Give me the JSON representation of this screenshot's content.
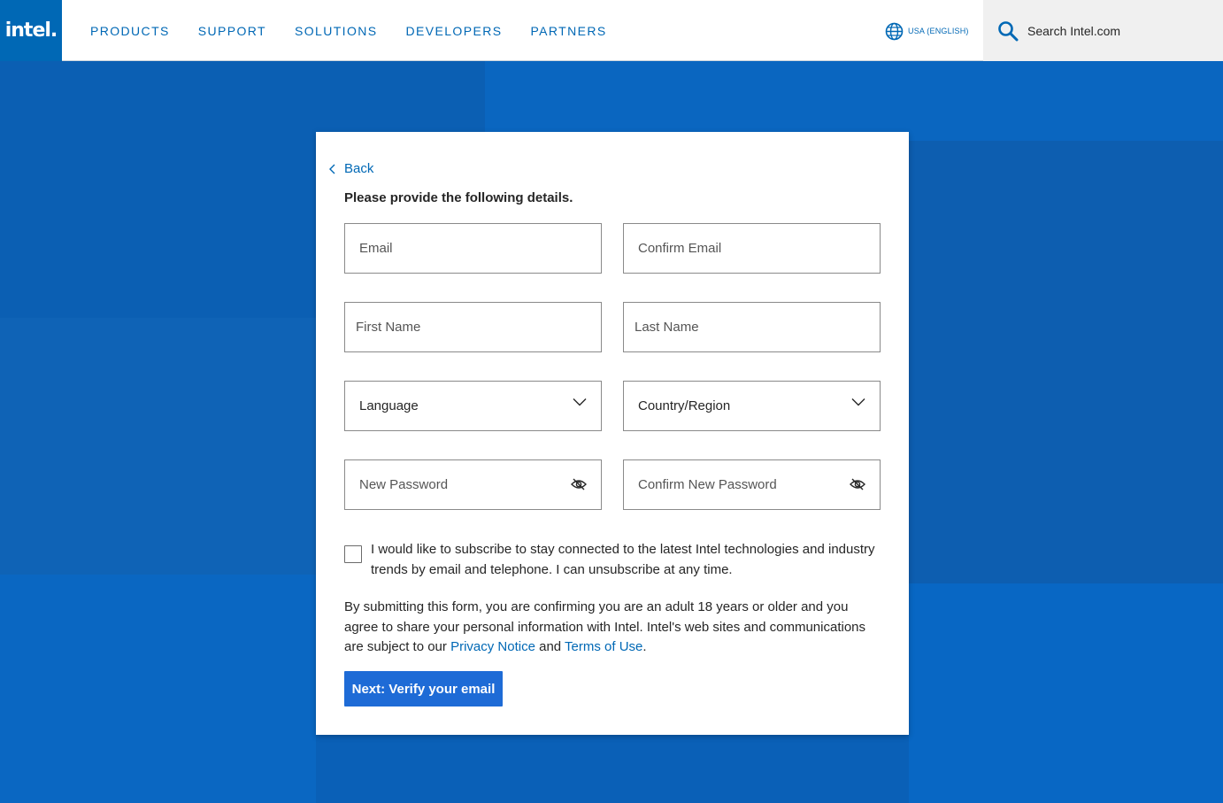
{
  "header": {
    "logo_text": "intel.",
    "nav": [
      "PRODUCTS",
      "SUPPORT",
      "SOLUTIONS",
      "DEVELOPERS",
      "PARTNERS"
    ],
    "locale_label": "USA (ENGLISH)",
    "search_placeholder": "Search Intel.com"
  },
  "form": {
    "back_label": "Back",
    "intro": "Please provide the following details.",
    "email_placeholder": "Email",
    "confirm_email_placeholder": "Confirm Email",
    "first_name_placeholder": "First Name",
    "last_name_placeholder": "Last Name",
    "language_label": "Language",
    "country_label": "Country/Region",
    "new_password_placeholder": "New Password",
    "confirm_password_placeholder": "Confirm New Password",
    "subscribe_text": "I would like to subscribe to stay connected to the latest Intel technologies and industry trends by email and telephone. I can unsubscribe at any time.",
    "subscribe_checked": false,
    "legal_prefix": "By submitting this form, you are confirming you are an adult 18 years or older and you agree to share your personal information with Intel. Intel's web sites and communications are subject to our ",
    "privacy_link": "Privacy Notice",
    "legal_and": " and ",
    "terms_link": "Terms of Use",
    "legal_suffix": ".",
    "next_button": "Next: Verify your email"
  },
  "colors": {
    "brand_blue": "#0068b5",
    "button_blue": "#1e6bd6",
    "background_blue": "#0a62b8"
  }
}
